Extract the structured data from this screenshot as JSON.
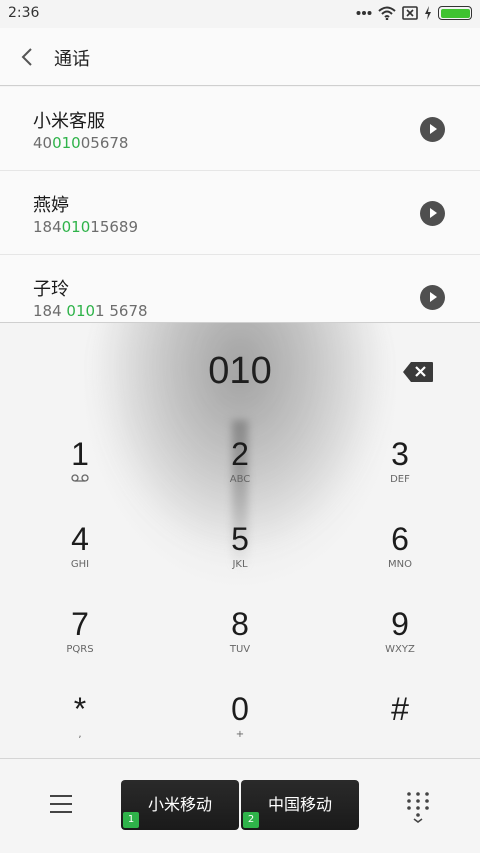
{
  "status": {
    "time": "2:36",
    "battery_level": 1.0,
    "battery_color": "#3fc330",
    "icons": [
      "dots-icon",
      "wifi-icon",
      "no-sim-icon",
      "charging-icon",
      "battery-icon"
    ]
  },
  "header": {
    "title": "通话"
  },
  "results": [
    {
      "name": "小米客服",
      "num_pre": "40",
      "num_hl": "010",
      "num_post": "05678"
    },
    {
      "name": "燕婷",
      "num_pre": "184",
      "num_hl": "010",
      "num_post": "15689"
    },
    {
      "name": "子玲",
      "num_pre": "184 ",
      "num_hl": "010",
      "num_post": "1 5678"
    }
  ],
  "dial": {
    "digits": "010"
  },
  "keys": [
    {
      "digit": "1",
      "letters": "voicemail"
    },
    {
      "digit": "2",
      "letters": "ABC"
    },
    {
      "digit": "3",
      "letters": "DEF"
    },
    {
      "digit": "4",
      "letters": "GHI"
    },
    {
      "digit": "5",
      "letters": "JKL"
    },
    {
      "digit": "6",
      "letters": "MNO"
    },
    {
      "digit": "7",
      "letters": "PQRS"
    },
    {
      "digit": "8",
      "letters": "TUV"
    },
    {
      "digit": "9",
      "letters": "WXYZ"
    },
    {
      "digit": "*",
      "letters": ","
    },
    {
      "digit": "0",
      "letters": "+"
    },
    {
      "digit": "#",
      "letters": ""
    }
  ],
  "bottom": {
    "sim1": {
      "label": "小米移动",
      "slot": "1"
    },
    "sim2": {
      "label": "中国移动",
      "slot": "2"
    }
  },
  "colors": {
    "highlight": "#2fb34a",
    "sim_button": "#1f1f1f"
  }
}
